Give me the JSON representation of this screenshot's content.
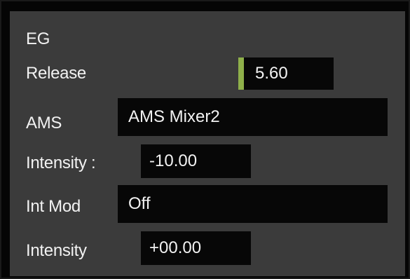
{
  "section_title": "EG",
  "colors": {
    "panel_bg": "#3b3b3b",
    "field_bg": "#070707",
    "text": "#f2f2f2",
    "accent": "#8fb04a"
  },
  "release": {
    "label": "Release",
    "value": "5.60"
  },
  "ams": {
    "label": "AMS",
    "value": "AMS Mixer2"
  },
  "intensity1": {
    "label": "Intensity :",
    "value": "-10.00"
  },
  "int_mod": {
    "label": "Int Mod",
    "value": "Off"
  },
  "intensity2": {
    "label": "Intensity",
    "value": "+00.00"
  }
}
